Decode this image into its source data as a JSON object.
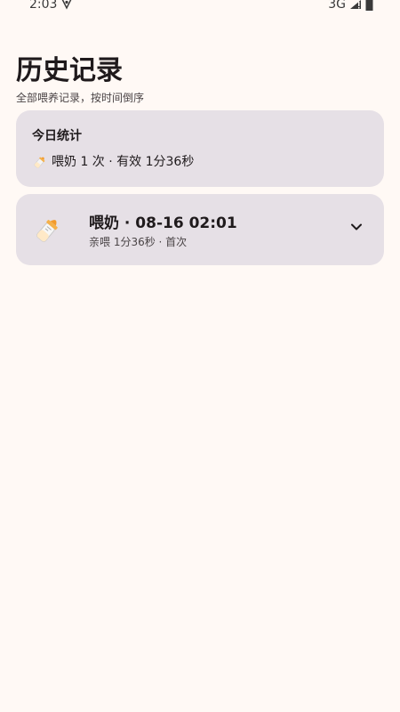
{
  "status_bar": {
    "time": "2:03",
    "network": "3G",
    "icons": [
      "vpn-shield-icon",
      "signal-icon",
      "battery-icon"
    ]
  },
  "header": {
    "title": "历史记录",
    "subtitle": "全部喂养记录，按时间倒序"
  },
  "today_stats": {
    "title": "今日统计",
    "icon": "baby-bottle-icon",
    "summary": "喂奶 1 次 · 有效 1分36秒"
  },
  "records": [
    {
      "icon": "baby-bottle-icon",
      "title": "喂奶 · 08-16 02:01",
      "detail": "亲喂 1分36秒 · 首次",
      "expand_icon": "chevron-down-icon"
    }
  ],
  "colors": {
    "background": "#fff9f5",
    "card": "#e6e0e6",
    "text": "#1f1a1c",
    "secondary_text": "#4a4446"
  }
}
